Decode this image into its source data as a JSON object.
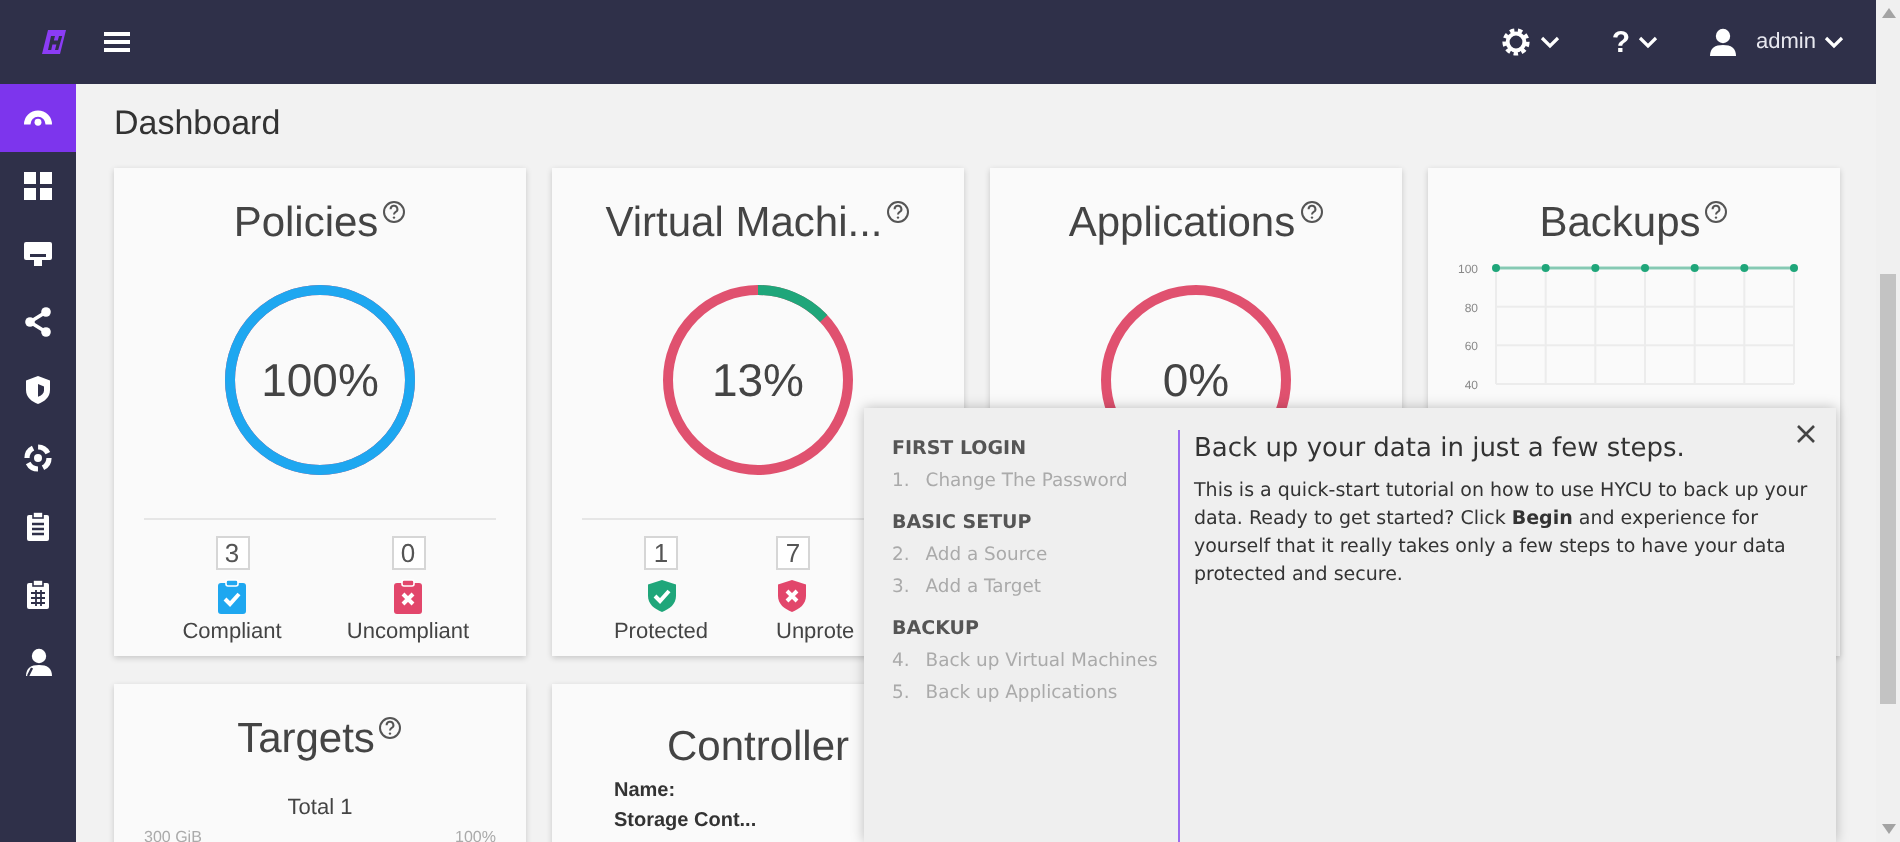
{
  "topbar": {
    "help": "?",
    "user": "admin"
  },
  "sidebar": {
    "items": [
      {
        "selected": true
      },
      {
        "selected": false
      },
      {
        "selected": false
      },
      {
        "selected": false
      },
      {
        "selected": false
      },
      {
        "selected": false
      },
      {
        "selected": false
      },
      {
        "selected": false
      },
      {
        "selected": false
      }
    ]
  },
  "page_title": "Dashboard",
  "cards": [
    {
      "kind": "donut",
      "title": "Policies",
      "value": "100%",
      "level": 1,
      "stats": [
        {
          "kind": "clipboard-check",
          "count": "3",
          "label": "Compliant"
        },
        {
          "kind": "clipboard-x",
          "count": "0",
          "label": "Uncompliant"
        }
      ]
    },
    {
      "kind": "donut",
      "title": "Virtual Machi...",
      "value": "13%",
      "level": 0.13,
      "stats": [
        {
          "kind": "shield-check",
          "count": "1",
          "label": "Protected"
        },
        {
          "kind": "shield-x",
          "count": "7",
          "label": "Unprote"
        }
      ]
    },
    {
      "kind": "donut",
      "title": "Applications",
      "value": "0%",
      "level": 0
    },
    {
      "kind": "chart",
      "title": "Backups",
      "chart_data": {
        "type": "line",
        "series": [
          {
            "color": "#1fa67a",
            "marker": true,
            "values": [
              100,
              100,
              100,
              100,
              100,
              100,
              100
            ]
          }
        ],
        "yticks": [
          40,
          60,
          80,
          100
        ],
        "ylim": [
          40,
          100
        ],
        "grid": true
      }
    },
    {
      "kind": "targets",
      "title": "Targets",
      "total": "Total 1",
      "left_label": "300 GiB",
      "right_label": "100%"
    },
    {
      "kind": "controller",
      "title": "Controller",
      "fields": [
        "Name:",
        "Storage Cont..."
      ]
    }
  ],
  "tutorial": {
    "sections": [
      {
        "title": "FIRST LOGIN",
        "steps": [
          {
            "number": "1.",
            "label": "Change The Password"
          }
        ]
      },
      {
        "title": "BASIC SETUP",
        "steps": [
          {
            "number": "2.",
            "label": "Add a Source"
          },
          {
            "number": "3.",
            "label": "Add a Target"
          }
        ]
      },
      {
        "title": "BACKUP",
        "steps": [
          {
            "number": "4.",
            "label": "Back up Virtual Machines"
          },
          {
            "number": "5.",
            "label": "Back up Applications"
          }
        ]
      }
    ],
    "heading": "Back up your data in just a few steps.",
    "body": "This is a quick-start tutorial on how to use HYCU to back up your data. Ready to get started? Click **Begin** and experience for yourself that it really takes only a few steps to have your data protected and secure."
  }
}
